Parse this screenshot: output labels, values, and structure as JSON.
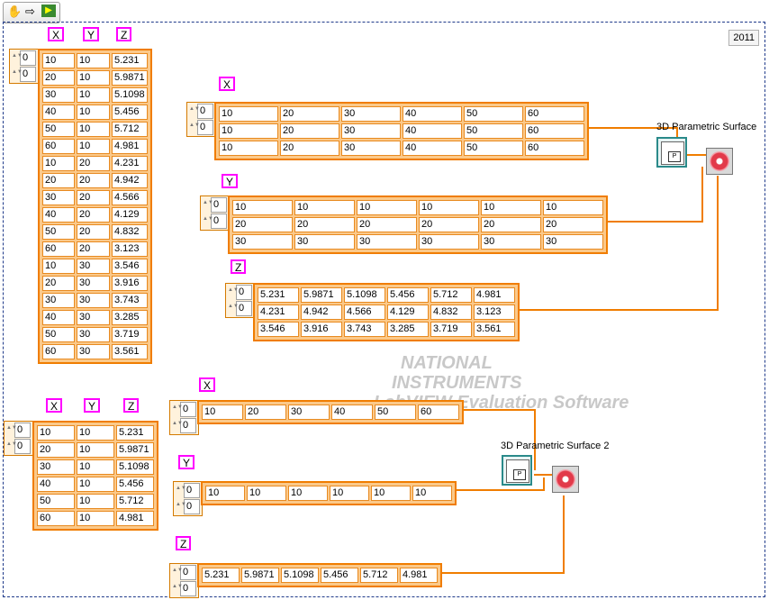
{
  "toolbar": {
    "icons": [
      "hand-icon",
      "arrow-icon",
      "run-icon"
    ]
  },
  "year_label": "2011",
  "labels": {
    "x": "X",
    "y": "Y",
    "z": "Z"
  },
  "index_values": [
    "0",
    "0"
  ],
  "table_big": [
    [
      "10",
      "10",
      "5.231"
    ],
    [
      "20",
      "10",
      "5.9871"
    ],
    [
      "30",
      "10",
      "5.1098"
    ],
    [
      "40",
      "10",
      "5.456"
    ],
    [
      "50",
      "10",
      "5.712"
    ],
    [
      "60",
      "10",
      "4.981"
    ],
    [
      "10",
      "20",
      "4.231"
    ],
    [
      "20",
      "20",
      "4.942"
    ],
    [
      "30",
      "20",
      "4.566"
    ],
    [
      "40",
      "20",
      "4.129"
    ],
    [
      "50",
      "20",
      "4.832"
    ],
    [
      "60",
      "20",
      "3.123"
    ],
    [
      "10",
      "30",
      "3.546"
    ],
    [
      "20",
      "30",
      "3.916"
    ],
    [
      "30",
      "30",
      "3.743"
    ],
    [
      "40",
      "30",
      "3.285"
    ],
    [
      "50",
      "30",
      "3.719"
    ],
    [
      "60",
      "30",
      "3.561"
    ]
  ],
  "table_small": [
    [
      "10",
      "10",
      "5.231"
    ],
    [
      "20",
      "10",
      "5.9871"
    ],
    [
      "30",
      "10",
      "5.1098"
    ],
    [
      "40",
      "10",
      "5.456"
    ],
    [
      "50",
      "10",
      "5.712"
    ],
    [
      "60",
      "10",
      "4.981"
    ]
  ],
  "x_matrix": [
    [
      "10",
      "20",
      "30",
      "40",
      "50",
      "60"
    ],
    [
      "10",
      "20",
      "30",
      "40",
      "50",
      "60"
    ],
    [
      "10",
      "20",
      "30",
      "40",
      "50",
      "60"
    ]
  ],
  "y_matrix": [
    [
      "10",
      "10",
      "10",
      "10",
      "10",
      "10"
    ],
    [
      "20",
      "20",
      "20",
      "20",
      "20",
      "20"
    ],
    [
      "30",
      "30",
      "30",
      "30",
      "30",
      "30"
    ]
  ],
  "z_matrix": [
    [
      "5.231",
      "5.9871",
      "5.1098",
      "5.456",
      "5.712",
      "4.981"
    ],
    [
      "4.231",
      "4.942",
      "4.566",
      "4.129",
      "4.832",
      "3.123"
    ],
    [
      "3.546",
      "3.916",
      "3.743",
      "3.285",
      "3.719",
      "3.561"
    ]
  ],
  "x_row": [
    "10",
    "20",
    "30",
    "40",
    "50",
    "60"
  ],
  "y_row": [
    "10",
    "10",
    "10",
    "10",
    "10",
    "10"
  ],
  "z_row": [
    "5.231",
    "5.9871",
    "5.1098",
    "5.456",
    "5.712",
    "4.981"
  ],
  "vi1_label": "3D Parametric Surface",
  "vi2_label": "3D Parametric Surface 2",
  "watermark": {
    "line1": "NATIONAL",
    "line2": "INSTRUMENTS",
    "line3": "LabVIEW Evaluation Software"
  },
  "colors": {
    "wire": "#f07d00",
    "label_border": "#ff00ff",
    "frame": "#1f3a8a"
  }
}
